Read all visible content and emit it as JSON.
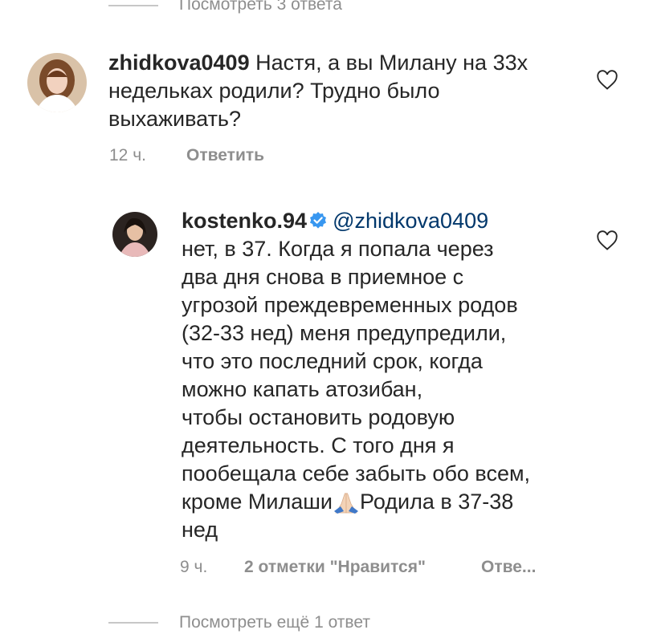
{
  "top_view_replies": "Посмотреть 3 ответа",
  "comments": [
    {
      "username": "zhidkova0409",
      "text": "Настя, а вы Милану на 33х недельках родили? Трудно было выхаживать?",
      "time": "12 ч.",
      "reply_label": "Ответить"
    },
    {
      "username": "kostenko.94",
      "verified": true,
      "mention": "@zhidkova0409",
      "text_lines": [
        "нет, в 37. Когда я попала через",
        "два дня снова в приемное  с",
        "угрозой преждевременных родов",
        "(32-33 нед) меня предупредили,",
        "что это последний срок, когда",
        "можно капать атозибан,",
        "чтобы остановить родовую",
        "деятельность. С того дня я",
        "пообещала себе  забыть обо всем,"
      ],
      "last_line_before_emoji": "кроме Милаши",
      "emoji_icon": "folded-hands-icon",
      "last_line_after_emoji": "Родила в 37-38",
      "final_line": "нед",
      "time": "9 ч.",
      "likes_label": "2 отметки \"Нравится\"",
      "reply_label": "Отве..."
    }
  ],
  "bottom_view_replies": "Посмотреть ещё 1 ответ",
  "colors": {
    "text": "#262626",
    "secondary": "#8e8e8e",
    "mention": "#00376b",
    "verified": "#3897f0"
  }
}
